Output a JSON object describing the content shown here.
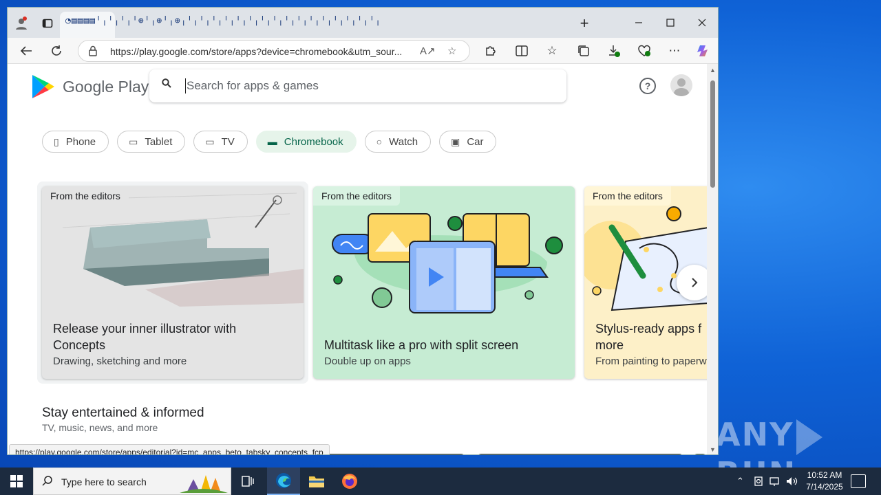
{
  "browser": {
    "tab_strip_text": "◔▤▤▤▤╵╷╵╷╵╷╵⊕╵╷⊕╵╷⊕╷╵╷╵╷╵╷╵╷╵╷╵╷╵╷╵╷╵╷╵╷╵╷╵╷╵╷╵╷╵╷╵╷",
    "new_tab": "+",
    "url": "https://play.google.com/store/apps?device=chromebook&utm_sour..."
  },
  "gp": {
    "logo_text": "Google Play",
    "search_placeholder": "Search for apps & games"
  },
  "chips": [
    {
      "label": "Phone",
      "icon": "phone-icon",
      "glyph": "▯"
    },
    {
      "label": "Tablet",
      "icon": "tablet-icon",
      "glyph": "▭"
    },
    {
      "label": "TV",
      "icon": "tv-icon",
      "glyph": "▭"
    },
    {
      "label": "Chromebook",
      "icon": "chromebook-icon",
      "glyph": "▬"
    },
    {
      "label": "Watch",
      "icon": "watch-icon",
      "glyph": "○"
    },
    {
      "label": "Car",
      "icon": "car-icon",
      "glyph": "▣"
    }
  ],
  "cards": [
    {
      "tag": "From the editors",
      "title_line1": "Release your inner illustrator with",
      "title_line2": "Concepts",
      "subtitle": "Drawing, sketching and more"
    },
    {
      "tag": "From the editors",
      "title_line1": "Multitask like a pro with split screen",
      "subtitle": "Double up on apps"
    },
    {
      "tag": "From the editors",
      "title_line1": "Stylus-ready apps f",
      "title_line2": "more",
      "subtitle": "From painting to paperw"
    }
  ],
  "section": {
    "title": "Stay entertained & informed",
    "subtitle": "TV, music, news, and more"
  },
  "status_url": "https://play.google.com/store/apps/editorial?id=mc_apps_beto_tabsky_concepts_fcp",
  "taskbar": {
    "search_text": "Type here to search",
    "time": "10:52 AM",
    "date": "7/14/2025"
  },
  "watermark": {
    "left": "ANY",
    "right": "RUN"
  },
  "colors": {
    "active_chip_bg": "#e6f4ea",
    "active_chip_text": "#056449",
    "card2_bg": "#c6ecd3",
    "card3_bg": "#fdf0c8"
  }
}
